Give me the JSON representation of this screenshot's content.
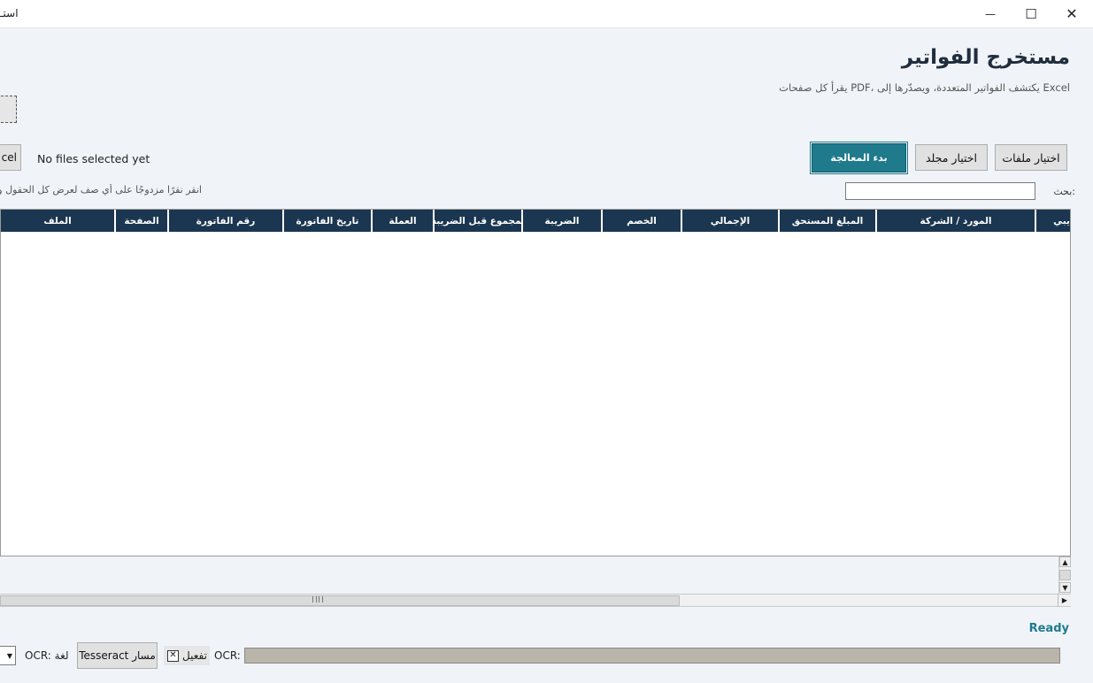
{
  "window": {
    "title": "استـ",
    "minimize_glyph": "—",
    "maximize_glyph": "☐",
    "close_glyph": "✕"
  },
  "header": {
    "title": "مستخرج الفواتير",
    "subtitle": "Excel يكتشف الفواتير المتعددة، ويصدّرها إلى ،PDF يقرأ كل صفحات"
  },
  "toolbar": {
    "choose_files": "اختيار ملفات",
    "choose_folder": "اختيار مجلد",
    "start_processing": "بدء المعالجة",
    "excel_partial": "cel",
    "files_status": "No files selected yet"
  },
  "search": {
    "label": ":بحث",
    "value": ""
  },
  "hint": "انقر نقرًا مزدوجًا على أي صف لعرض كل الحقول وا",
  "table": {
    "columns": [
      "يبي",
      "المورد / الشركة",
      "المبلغ المستحق",
      "الإجمالي",
      "الخصم",
      "الضريبة",
      "لمجموع قبل الضريبة",
      "العملة",
      "تاريخ الفاتورة",
      "رقم الفاتورة",
      "الصفحة",
      "الملف"
    ],
    "rows": []
  },
  "status": {
    "ready": "Ready"
  },
  "bottom": {
    "ocr_label": "OCR:",
    "enable_label": "تفعيل",
    "enable_checked": true,
    "checkbox_glyph": "✕",
    "tesseract_button": "Tesseract مسار",
    "lang_label": "OCR: لغة"
  },
  "icons": {
    "scroll_up": "▲",
    "scroll_down": "▼",
    "scroll_right": "▶",
    "select_arrow": "▼"
  },
  "colors": {
    "accent": "#1f7a8c",
    "table_header": "#1b3650",
    "background": "#f0f4f8"
  }
}
